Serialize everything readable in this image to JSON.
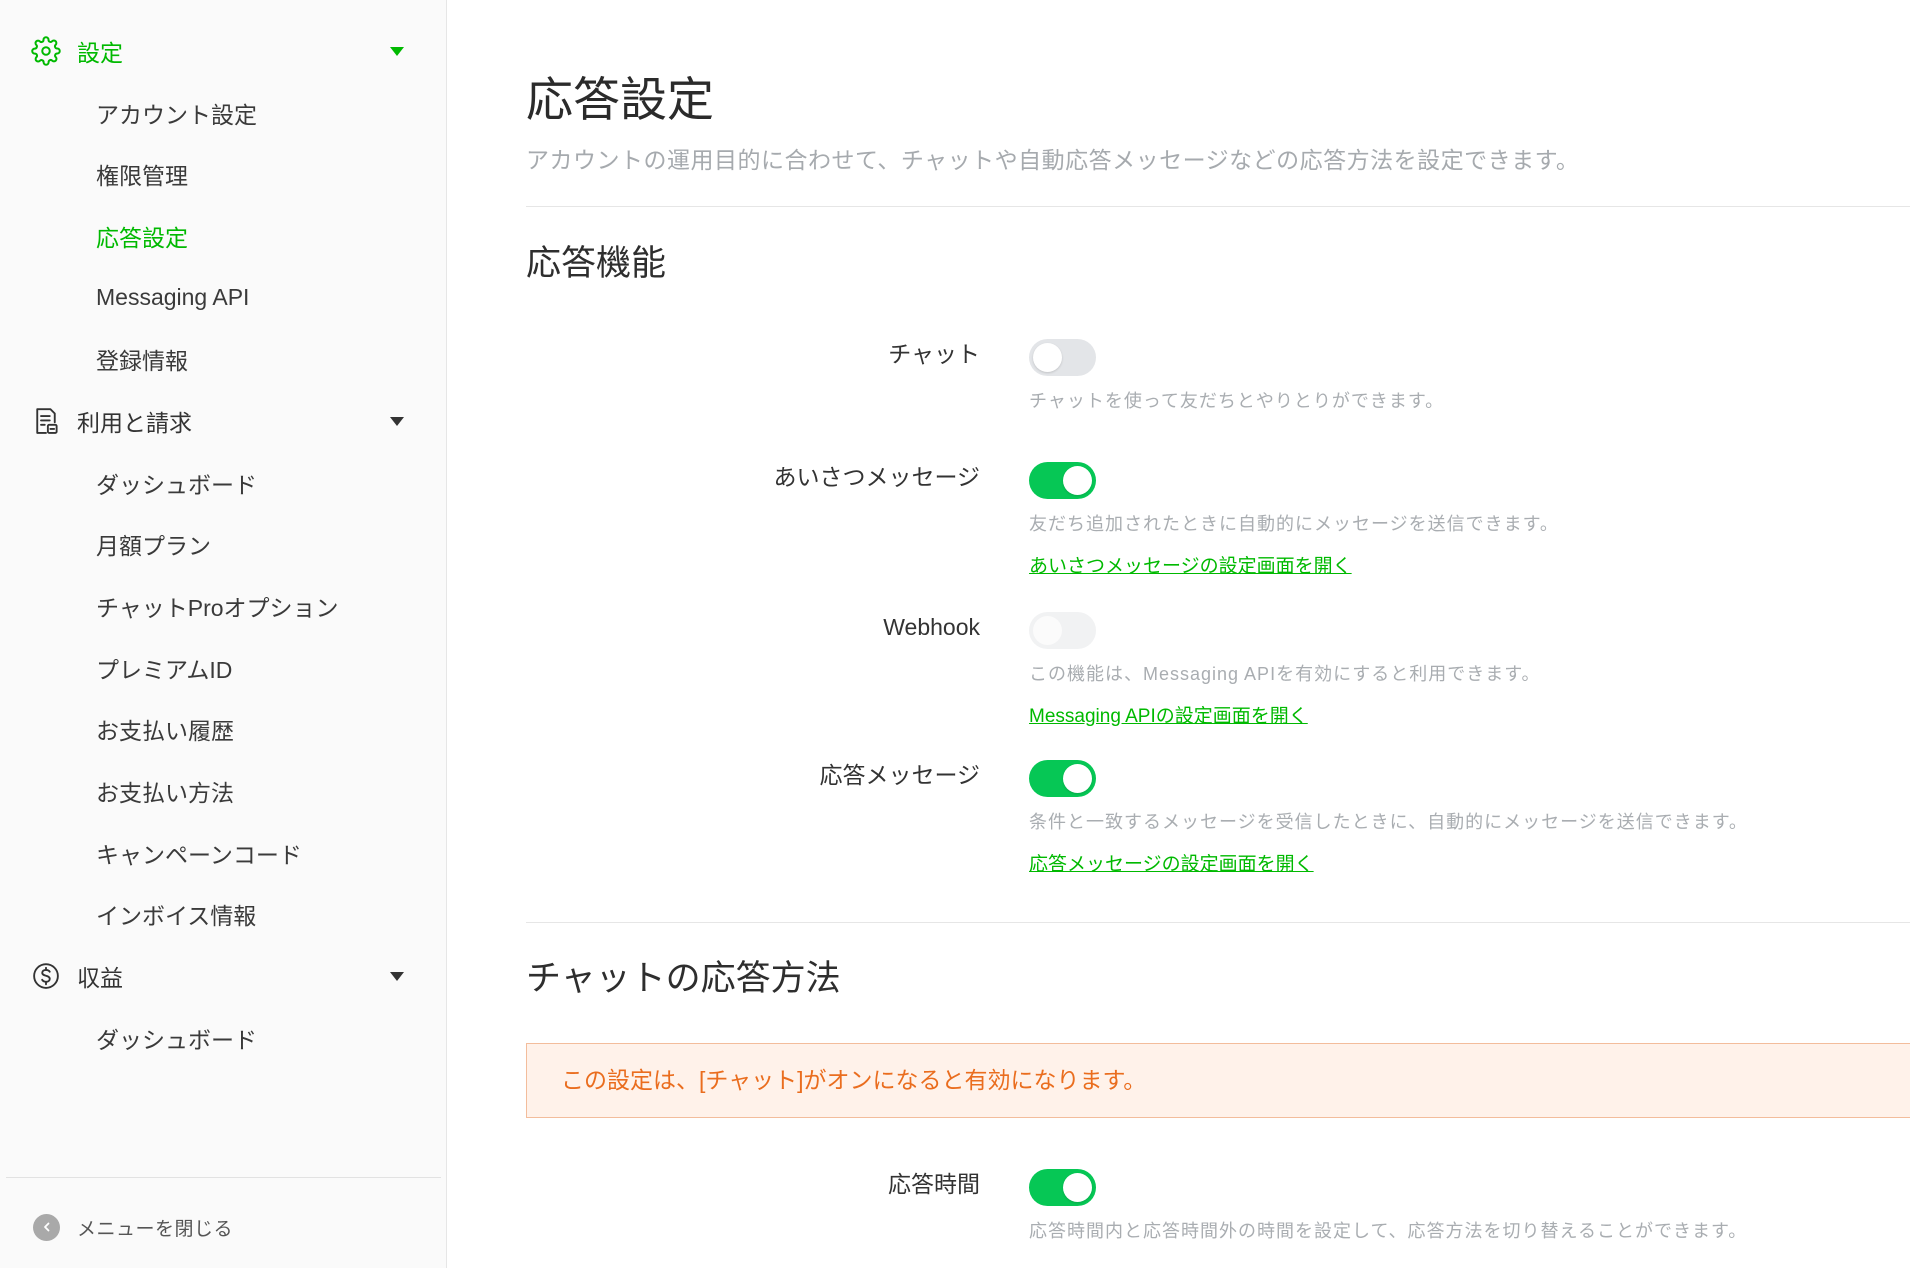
{
  "colors": {
    "accent": "#06c755",
    "active": "#00b900",
    "notice_text": "#ea6d1e",
    "notice_bg": "#fff2ea",
    "notice_border": "#f3bd9c"
  },
  "sidebar": {
    "sections": [
      {
        "label": "設定",
        "icon": "gear-icon",
        "active": true,
        "expanded": true,
        "items": [
          {
            "label": "アカウント設定"
          },
          {
            "label": "権限管理"
          },
          {
            "label": "応答設定",
            "active": true
          },
          {
            "label": "Messaging API"
          },
          {
            "label": "登録情報"
          }
        ]
      },
      {
        "label": "利用と請求",
        "icon": "document-icon",
        "expanded": true,
        "items": [
          {
            "label": "ダッシュボード"
          },
          {
            "label": "月額プラン"
          },
          {
            "label": "チャットProオプション"
          },
          {
            "label": "プレミアムID"
          },
          {
            "label": "お支払い履歴"
          },
          {
            "label": "お支払い方法"
          },
          {
            "label": "キャンペーンコード"
          },
          {
            "label": "インボイス情報"
          }
        ]
      },
      {
        "label": "収益",
        "icon": "dollar-icon",
        "expanded": true,
        "items": [
          {
            "label": "ダッシュボード"
          }
        ]
      }
    ],
    "close_menu_label": "メニューを閉じる"
  },
  "page": {
    "title": "応答設定",
    "subtitle": "アカウントの運用目的に合わせて、チャットや自動応答メッセージなどの応答方法を設定できます。"
  },
  "response_features": {
    "heading": "応答機能",
    "rows": [
      {
        "label": "チャット",
        "enabled": false,
        "description": "チャットを使って友だちとやりとりができます。"
      },
      {
        "label": "あいさつメッセージ",
        "enabled": true,
        "description": "友だち追加されたときに自動的にメッセージを送信できます。",
        "link": "あいさつメッセージの設定画面を開く"
      },
      {
        "label": "Webhook",
        "enabled": false,
        "disabled": true,
        "description": "この機能は、Messaging APIを有効にすると利用できます。",
        "link": "Messaging APIの設定画面を開く"
      },
      {
        "label": "応答メッセージ",
        "enabled": true,
        "description": "条件と一致するメッセージを受信したときに、自動的にメッセージを送信できます。",
        "link": "応答メッセージの設定画面を開く"
      }
    ]
  },
  "chat_response": {
    "heading": "チャットの応答方法",
    "notice": "この設定は、[チャット]がオンになると有効になります。",
    "rows": [
      {
        "label": "応答時間",
        "enabled": true,
        "description": "応答時間内と応答時間外の時間を設定して、応答方法を切り替えることができます。"
      }
    ]
  }
}
